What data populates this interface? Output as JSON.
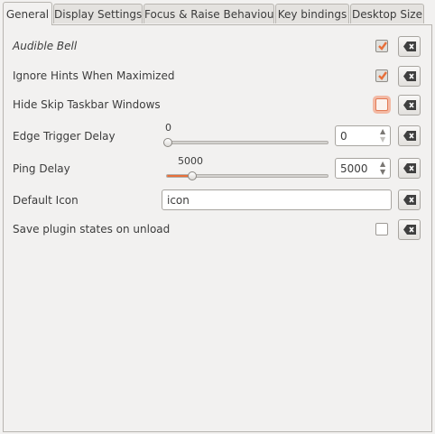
{
  "tabs": [
    {
      "label": "General",
      "active": true
    },
    {
      "label": "Display Settings",
      "active": false
    },
    {
      "label": "Focus & Raise Behaviour",
      "active": false
    },
    {
      "label": "Key bindings",
      "active": false
    },
    {
      "label": "Desktop Size",
      "active": false
    }
  ],
  "settings": {
    "audible_bell": {
      "label": "Audible Bell",
      "checked": true
    },
    "ignore_hints": {
      "label": "Ignore Hints When Maximized",
      "checked": true
    },
    "hide_skip_taskbar": {
      "label": "Hide Skip Taskbar Windows",
      "checked": false
    },
    "edge_trigger_delay": {
      "label": "Edge Trigger Delay",
      "value": "0",
      "slider_fraction": 0.0
    },
    "ping_delay": {
      "label": "Ping Delay",
      "value": "5000",
      "slider_fraction": 0.15
    },
    "default_icon": {
      "label": "Default Icon",
      "value": "icon"
    },
    "save_plugin_states": {
      "label": "Save plugin states on unload",
      "checked": false
    }
  },
  "colors": {
    "accent": "#e76f3a",
    "focus_ring": "#f3b9a4"
  },
  "icons": {
    "check": "checkmark-icon",
    "reset": "clear-backspace-icon",
    "spin_up": "chevron-up-icon",
    "spin_down": "chevron-down-icon"
  }
}
